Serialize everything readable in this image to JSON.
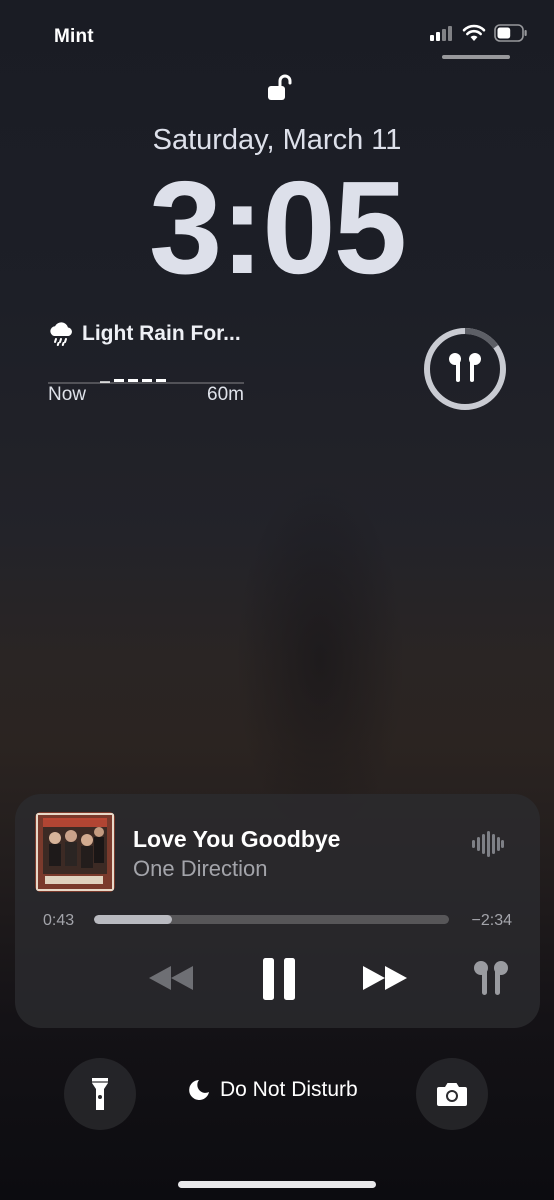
{
  "status_bar": {
    "carrier": "Mint",
    "signal_icon": "signal-bars-icon",
    "wifi_icon": "wifi-icon",
    "battery_icon": "battery-icon",
    "battery_level": 0.55
  },
  "lock": {
    "icon": "unlocked-padlock-icon"
  },
  "date": "Saturday, March 11",
  "time": "3:05",
  "weather": {
    "icon": "rain-cloud-icon",
    "title": "Light Rain For...",
    "start_label": "Now",
    "end_label": "60m"
  },
  "airpods_widget": {
    "icon": "airpods-icon",
    "battery_fraction": 0.15
  },
  "now_playing": {
    "album_art": "album-art-made-in-the-am",
    "title": "Love You Goodbye",
    "artist": "One Direction",
    "elapsed": "0:43",
    "remaining": "−2:34",
    "progress": 0.22,
    "controls": {
      "rewind_icon": "rewind-icon",
      "pause_icon": "pause-icon",
      "forward_icon": "fast-forward-icon",
      "output_icon": "airpods-icon"
    }
  },
  "bottom": {
    "flashlight_icon": "flashlight-icon",
    "dnd_label": "Do Not Disturb",
    "dnd_icon": "moon-icon",
    "camera_icon": "camera-icon"
  },
  "colors": {
    "accent": "#dde0ea",
    "secondary_text": "#a3a4aa"
  }
}
